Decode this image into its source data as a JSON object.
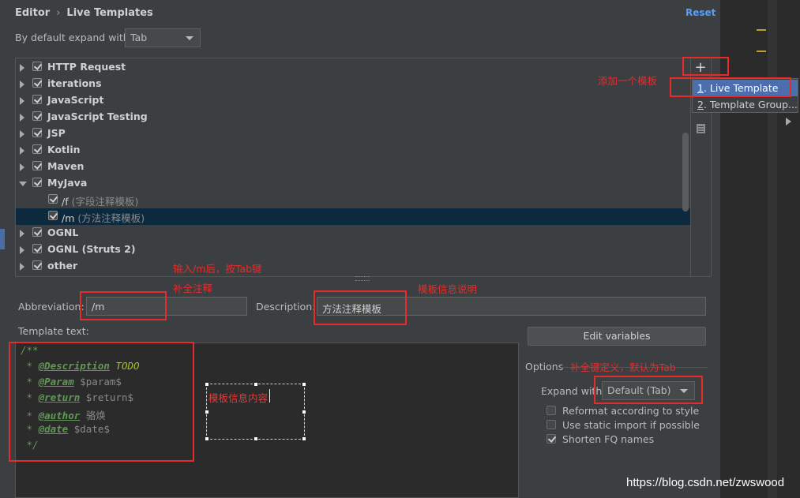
{
  "breadcrumb": {
    "section": "Editor",
    "separator": "›",
    "page": "Live Templates"
  },
  "reset_label": "Reset",
  "expand_default": {
    "label": "By default expand with",
    "value": "Tab"
  },
  "tree": [
    {
      "label": "HTTP Request",
      "expanded": false,
      "checked": true
    },
    {
      "label": "iterations",
      "expanded": false,
      "checked": true
    },
    {
      "label": "JavaScript",
      "expanded": false,
      "checked": true
    },
    {
      "label": "JavaScript Testing",
      "expanded": false,
      "checked": true
    },
    {
      "label": "JSP",
      "expanded": false,
      "checked": true
    },
    {
      "label": "Kotlin",
      "expanded": false,
      "checked": true
    },
    {
      "label": "Maven",
      "expanded": false,
      "checked": true
    },
    {
      "label": "MyJava",
      "expanded": true,
      "checked": true
    },
    {
      "label": "/f",
      "desc": "(字段注释模板)",
      "child": true,
      "checked": true
    },
    {
      "label": "/m",
      "desc": "(方法注释模板)",
      "child": true,
      "checked": true,
      "selected": true
    },
    {
      "label": "OGNL",
      "expanded": false,
      "checked": true
    },
    {
      "label": "OGNL (Struts 2)",
      "expanded": false,
      "checked": true
    },
    {
      "label": "other",
      "expanded": false,
      "checked": true
    }
  ],
  "toolbar": {
    "add_symbol": "+"
  },
  "popup": {
    "items": [
      {
        "mnemonic": "1",
        "label": ". Live Template"
      },
      {
        "mnemonic": "2",
        "label": ". Template Group..."
      }
    ]
  },
  "abbreviation": {
    "label": "Abbreviation:",
    "value": "/m"
  },
  "description": {
    "label": "Description:",
    "value": "方法注释模板"
  },
  "template_text_label": "Template text:",
  "template_lines": [
    {
      "pre": "/**",
      "tag": "",
      "rest": ""
    },
    {
      "pre": " * ",
      "tag": "@Description",
      "rest": " TODO"
    },
    {
      "pre": " * ",
      "tag": "@Param",
      "rest": " $param$"
    },
    {
      "pre": " * ",
      "tag": "@return",
      "rest": " $return$"
    },
    {
      "pre": " * ",
      "tag": "@author",
      "rest": " 骆焕"
    },
    {
      "pre": " * ",
      "tag": "@date",
      "rest": " $date$"
    },
    {
      "pre": " */",
      "tag": "",
      "rest": ""
    }
  ],
  "edit_variables_label": "Edit variables",
  "options": {
    "label": "Options",
    "expand_with_label": "Expand with",
    "expand_with_value": "Default (Tab)",
    "checkboxes": [
      {
        "label": "Reformat according to style",
        "checked": false
      },
      {
        "label": "Use static import if possible",
        "checked": false
      },
      {
        "label": "Shorten FQ names",
        "checked": true
      }
    ]
  },
  "annotations": {
    "add_template": "添加一个模板",
    "type_m": "输入/m后，按Tab键",
    "complete_comment": "补全注释",
    "template_desc": "模板信息说明",
    "template_content": "模板信息内容",
    "completion_key": "补全键定义，默认为Tab"
  },
  "watermark": "https://blog.csdn.net/zwswood",
  "colors": {
    "annotation_red": "#e62b2b",
    "selection_blue": "#4b6eaf",
    "link_blue": "#589df6"
  }
}
